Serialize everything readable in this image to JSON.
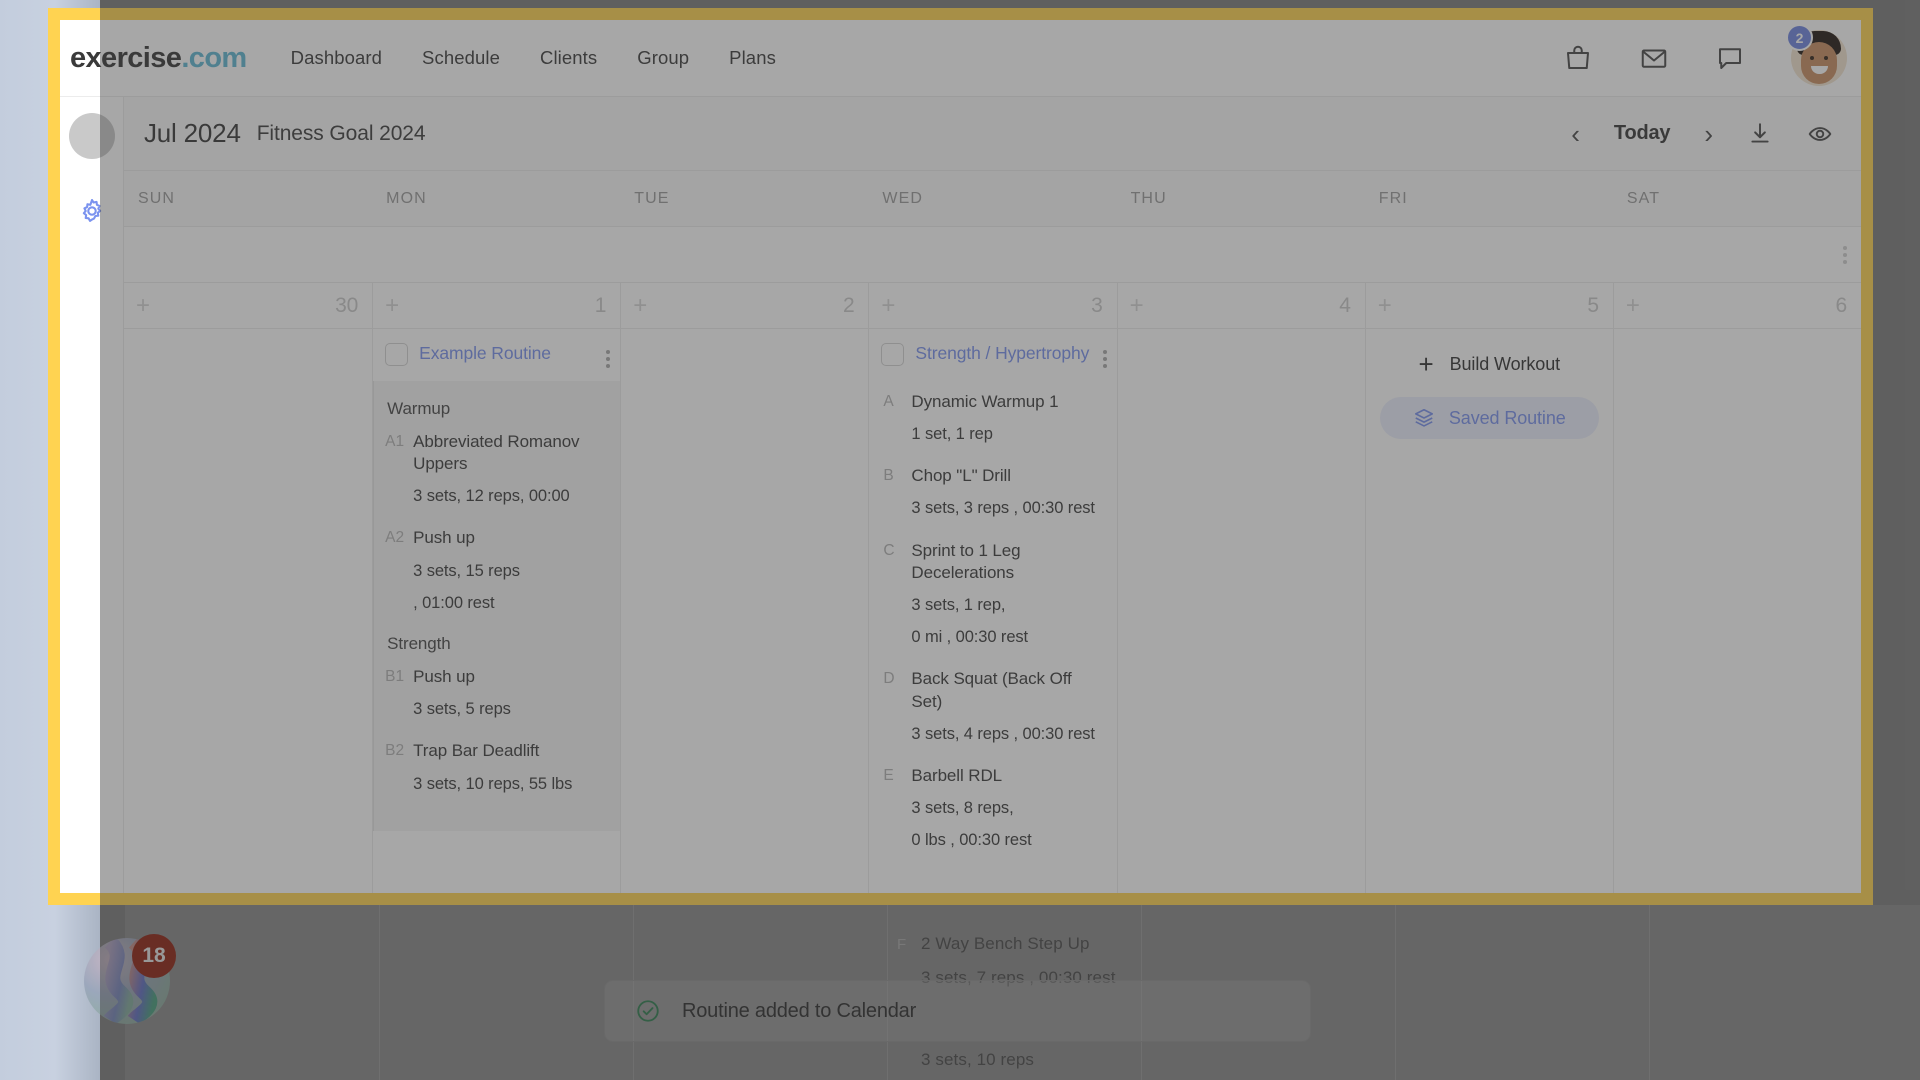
{
  "topnav": {
    "brand_main": "exercise",
    "brand_suffix": ".com",
    "links": [
      {
        "label": "Dashboard"
      },
      {
        "label": "Schedule"
      },
      {
        "label": "Clients"
      },
      {
        "label": "Group"
      },
      {
        "label": "Plans"
      }
    ],
    "icons": [
      {
        "name": "shopping-bag-icon"
      },
      {
        "name": "mail-icon"
      },
      {
        "name": "chat-icon"
      }
    ],
    "notification_count": "2"
  },
  "calendar_header": {
    "month": "Jul 2024",
    "plan_name": "Fitness Goal 2024",
    "prev_label": "‹",
    "today_label": "Today",
    "next_label": "›",
    "download_icon": "download-icon",
    "preview_icon": "eye-icon"
  },
  "days": [
    {
      "dow": "SUN",
      "date": "30",
      "plus": "+"
    },
    {
      "dow": "MON",
      "date": "1",
      "plus": "+"
    },
    {
      "dow": "TUE",
      "date": "2",
      "plus": "+"
    },
    {
      "dow": "WED",
      "date": "3",
      "plus": "+"
    },
    {
      "dow": "THU",
      "date": "4",
      "plus": "+"
    },
    {
      "dow": "FRI",
      "date": "5",
      "plus": "+"
    },
    {
      "dow": "SAT",
      "date": "6",
      "plus": "+"
    }
  ],
  "monday_routine": {
    "title": "Example Routine",
    "sections": [
      {
        "title": "Warmup",
        "exercises": [
          {
            "letter": "A1",
            "name": "Abbreviated Romanov Uppers",
            "detail": "3 sets, 12 reps, 00:00"
          },
          {
            "letter": "A2",
            "name": "Push up",
            "detail": "3 sets, 15 reps",
            "detail2": ", 01:00 rest"
          }
        ]
      },
      {
        "title": "Strength",
        "exercises": [
          {
            "letter": "B1",
            "name": "Push up",
            "detail": "3 sets, 5 reps"
          },
          {
            "letter": "B2",
            "name": "Trap Bar Deadlift",
            "detail": "3 sets, 10 reps, 55 lbs"
          }
        ]
      }
    ]
  },
  "wednesday_routine": {
    "title": "Strength / Hypertrophy",
    "exercises": [
      {
        "letter": "A",
        "name": "Dynamic Warmup 1",
        "detail": "1 set, 1 rep"
      },
      {
        "letter": "B",
        "name": "Chop \"L\" Drill",
        "detail": "3 sets, 3 reps , 00:30 rest"
      },
      {
        "letter": "C",
        "name": "Sprint to 1 Leg Decelerations",
        "detail": "3 sets, 1 rep,",
        "detail2": "0 mi , 00:30 rest"
      },
      {
        "letter": "D",
        "name": "Back Squat (Back Off Set)",
        "detail": "3 sets, 4 reps , 00:30 rest"
      },
      {
        "letter": "E",
        "name": "Barbell RDL",
        "detail": "3 sets, 8 reps,",
        "detail2": "0 lbs , 00:30 rest"
      }
    ],
    "clipped_exercises": [
      {
        "letter": "F",
        "name": "2 Way Bench Step Up",
        "detail": "3 sets, 7 reps , 00:30 rest"
      },
      {
        "letter": "",
        "name": "",
        "detail": "3 sets, 10 reps"
      }
    ]
  },
  "friday_actions": {
    "build_label": "Build Workout",
    "build_plus": "+",
    "saved_label": "Saved Routine",
    "saved_icon": "layers-icon"
  },
  "toast": {
    "message": "Routine added to Calendar",
    "icon": "check-circle-icon"
  },
  "chat_widget": {
    "unread": "18"
  },
  "rail": {
    "avatar_name": "rail-avatar",
    "gear_icon": "gear-icon"
  },
  "colors": {
    "highlight_border": "#FFD351",
    "accent_blue": "#7b93ef",
    "brand_teal": "#62b8d4",
    "success_green": "#2f7d4f"
  }
}
